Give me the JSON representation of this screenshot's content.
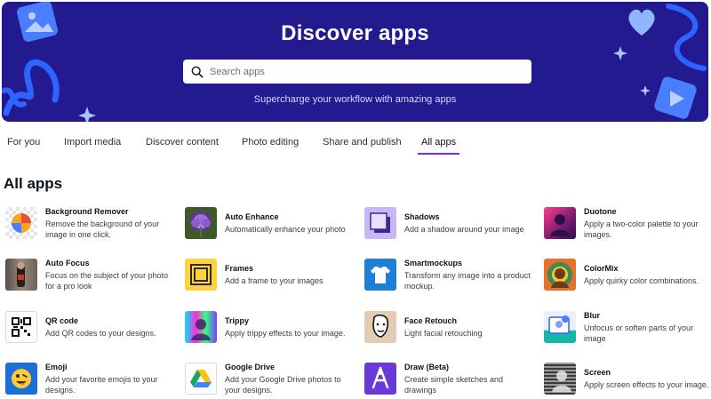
{
  "hero": {
    "title": "Discover apps",
    "search_placeholder": "Search apps",
    "subtitle": "Supercharge your workflow with amazing apps",
    "bg_color": "#241a8f"
  },
  "tabs": [
    {
      "label": "For you",
      "active": false
    },
    {
      "label": "Import media",
      "active": false
    },
    {
      "label": "Discover content",
      "active": false
    },
    {
      "label": "Photo editing",
      "active": false
    },
    {
      "label": "Share and publish",
      "active": false
    },
    {
      "label": "All apps",
      "active": true
    }
  ],
  "accent_color": "#7d2ae8",
  "section": {
    "title": "All apps"
  },
  "apps": [
    {
      "name": "Background Remover",
      "desc_lines": [
        "Remove the background of your",
        "image in one click."
      ],
      "icon": "background-remover-icon"
    },
    {
      "name": "Auto Enhance",
      "desc_lines": [
        "Automatically enhance your photo"
      ],
      "icon": "auto-enhance-icon"
    },
    {
      "name": "Shadows",
      "desc_lines": [
        "Add a shadow around your image"
      ],
      "icon": "shadows-icon"
    },
    {
      "name": "Duotone",
      "desc_lines": [
        "Apply a two-color palette to your",
        "images."
      ],
      "icon": "duotone-icon"
    },
    {
      "name": "Auto Focus",
      "desc_lines": [
        "Focus on the subject of your photo",
        "for a pro look"
      ],
      "icon": "auto-focus-icon"
    },
    {
      "name": "Frames",
      "desc_lines": [
        "Add a frame to your images"
      ],
      "icon": "frames-icon"
    },
    {
      "name": "Smartmockups",
      "desc_lines": [
        "Transform any image into a product",
        "mockup."
      ],
      "icon": "smartmockups-icon"
    },
    {
      "name": "ColorMix",
      "desc_lines": [
        "Apply quirky color combinations."
      ],
      "icon": "colormix-icon"
    },
    {
      "name": "QR code",
      "desc_lines": [
        "Add QR codes to your designs."
      ],
      "icon": "qr-code-icon"
    },
    {
      "name": "Trippy",
      "desc_lines": [
        "Apply trippy effects to your image."
      ],
      "icon": "trippy-icon"
    },
    {
      "name": "Face Retouch",
      "desc_lines": [
        "Light facial retouching"
      ],
      "icon": "face-retouch-icon"
    },
    {
      "name": "Blur",
      "desc_lines": [
        "Unfocus or soften parts of your",
        "image"
      ],
      "icon": "blur-icon"
    },
    {
      "name": "Emoji",
      "desc_lines": [
        "Add your favorite emojis to your",
        "designs."
      ],
      "icon": "emoji-icon"
    },
    {
      "name": "Google Drive",
      "desc_lines": [
        "Add your Google Drive photos to",
        "your designs."
      ],
      "icon": "google-drive-icon"
    },
    {
      "name": "Draw (Beta)",
      "desc_lines": [
        "Create simple sketches and",
        "drawings"
      ],
      "icon": "draw-icon"
    },
    {
      "name": "Screen",
      "desc_lines": [
        "Apply screen effects to your image."
      ],
      "icon": "screen-icon"
    }
  ]
}
